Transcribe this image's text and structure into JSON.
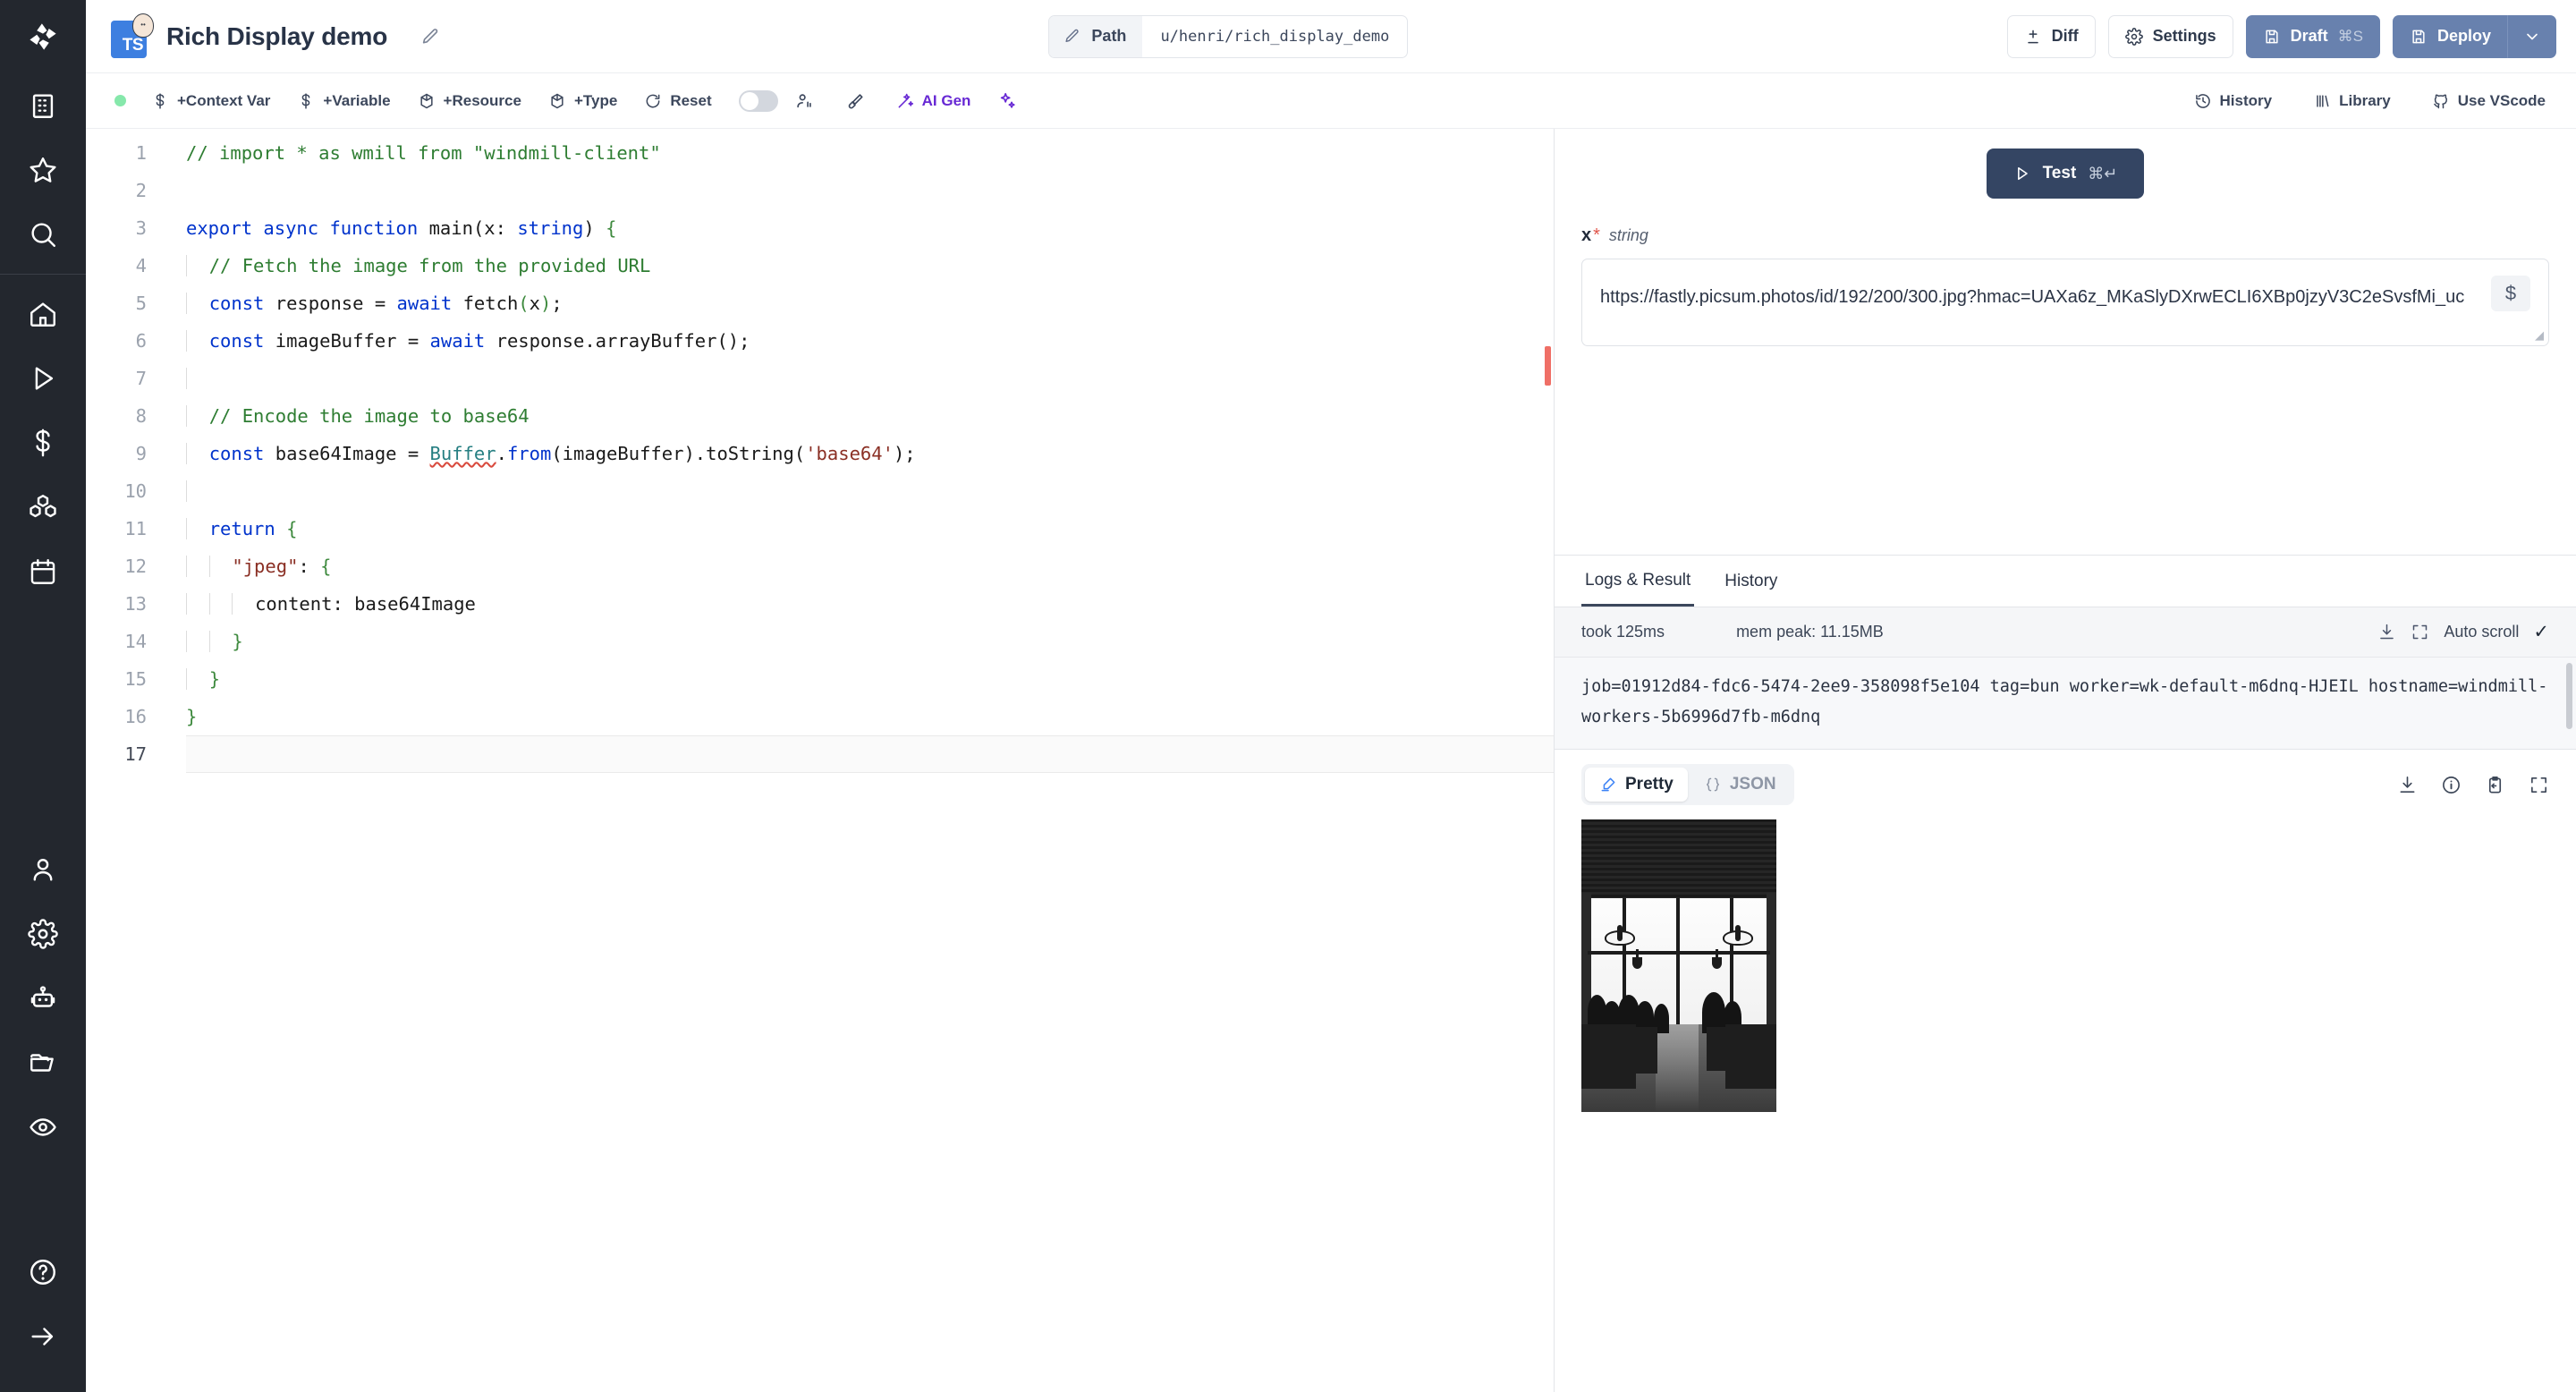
{
  "app": {
    "title": "Rich Display demo",
    "language_badge": "TS"
  },
  "topbar": {
    "edit_title_icon": "pencil-icon",
    "path": {
      "label": "Path",
      "value": "u/henri/rich_display_demo",
      "icon": "pencil-icon"
    },
    "diff_label": "Diff",
    "settings_label": "Settings",
    "draft_label": "Draft",
    "draft_shortcut": "⌘S",
    "deploy_label": "Deploy",
    "primary_color": "#6881ae"
  },
  "subbar": {
    "status": "ok",
    "items": [
      {
        "label": "+Context Var",
        "icon": "dollar-icon"
      },
      {
        "label": "+Variable",
        "icon": "dollar-icon"
      },
      {
        "label": "+Resource",
        "icon": "box-icon"
      },
      {
        "label": "+Type",
        "icon": "box-icon"
      },
      {
        "label": "Reset",
        "icon": "refresh-icon"
      }
    ],
    "collab_toggle": "off",
    "collab_icon": "users-icon",
    "format_icon": "brush-icon",
    "ai_gen_label": "AI Gen",
    "ai_gen_icon": "wand-icon",
    "ai_sparkle_icon": "sparkles-icon",
    "ai_color": "#6728d4",
    "right_items": [
      {
        "label": "History",
        "icon": "history-icon"
      },
      {
        "label": "Library",
        "icon": "library-icon"
      },
      {
        "label": "Use VScode",
        "icon": "github-icon"
      }
    ]
  },
  "sidebar": {
    "logo_icon": "windmill-logo-icon",
    "items": [
      {
        "name": "workspace",
        "icon": "building-icon"
      },
      {
        "name": "favorites",
        "icon": "star-icon"
      },
      {
        "name": "search",
        "icon": "search-icon"
      },
      {
        "name": "home",
        "icon": "home-icon"
      },
      {
        "name": "runs",
        "icon": "play-icon"
      },
      {
        "name": "variables",
        "icon": "dollar-icon"
      },
      {
        "name": "resources",
        "icon": "cubes-icon"
      },
      {
        "name": "schedules",
        "icon": "calendar-icon"
      },
      {
        "name": "workers",
        "icon": "user-icon"
      },
      {
        "name": "settings",
        "icon": "gear-icon"
      },
      {
        "name": "ai-agents",
        "icon": "robot-icon"
      },
      {
        "name": "folders",
        "icon": "folder-icon"
      },
      {
        "name": "audit-logs",
        "icon": "eye-icon"
      },
      {
        "name": "help",
        "icon": "question-circle-icon"
      },
      {
        "name": "expand-sidebar",
        "icon": "arrow-right-icon"
      }
    ]
  },
  "editor": {
    "total_lines": 17,
    "cursor_line": 17,
    "lines": [
      {
        "n": 1,
        "tokens": [
          {
            "t": "com",
            "v": "// import * as wmill from \"windmill-client\""
          }
        ]
      },
      {
        "n": 2,
        "tokens": []
      },
      {
        "n": 3,
        "tokens": [
          {
            "t": "kw",
            "v": "export"
          },
          {
            "t": "plain",
            "v": " "
          },
          {
            "t": "kw",
            "v": "async"
          },
          {
            "t": "plain",
            "v": " "
          },
          {
            "t": "kw",
            "v": "function"
          },
          {
            "t": "plain",
            "v": " "
          },
          {
            "t": "fn",
            "v": "main"
          },
          {
            "t": "punc",
            "v": "("
          },
          {
            "t": "plain",
            "v": "x: "
          },
          {
            "t": "type",
            "v": "string"
          },
          {
            "t": "punc",
            "v": ") "
          },
          {
            "t": "brace",
            "v": "{"
          }
        ]
      },
      {
        "n": 4,
        "indent": 1,
        "tokens": [
          {
            "t": "com",
            "v": "// Fetch the image from the provided URL"
          }
        ]
      },
      {
        "n": 5,
        "indent": 1,
        "tokens": [
          {
            "t": "kw",
            "v": "const"
          },
          {
            "t": "plain",
            "v": " response = "
          },
          {
            "t": "kw",
            "v": "await"
          },
          {
            "t": "plain",
            "v": " fetch"
          },
          {
            "t": "brace",
            "v": "("
          },
          {
            "t": "plain",
            "v": "x"
          },
          {
            "t": "brace",
            "v": ")"
          },
          {
            "t": "plain",
            "v": ";"
          }
        ]
      },
      {
        "n": 6,
        "indent": 1,
        "tokens": [
          {
            "t": "kw",
            "v": "const"
          },
          {
            "t": "plain",
            "v": " imageBuffer = "
          },
          {
            "t": "kw",
            "v": "await"
          },
          {
            "t": "plain",
            "v": " response.arrayBuffer();"
          }
        ]
      },
      {
        "n": 7,
        "indent": 1,
        "tokens": []
      },
      {
        "n": 8,
        "indent": 1,
        "tokens": [
          {
            "t": "com",
            "v": "// Encode the image to base64"
          }
        ]
      },
      {
        "n": 9,
        "indent": 1,
        "tokens": [
          {
            "t": "kw",
            "v": "const"
          },
          {
            "t": "plain",
            "v": " base64Image = "
          },
          {
            "t": "cls-squiggle",
            "v": "Buffer"
          },
          {
            "t": "plain",
            "v": "."
          },
          {
            "t": "kw",
            "v": "from"
          },
          {
            "t": "punc",
            "v": "("
          },
          {
            "t": "plain",
            "v": "imageBuffer"
          },
          {
            "t": "punc",
            "v": ")."
          },
          {
            "t": "plain",
            "v": "toString"
          },
          {
            "t": "punc",
            "v": "("
          },
          {
            "t": "str",
            "v": "'base64'"
          },
          {
            "t": "punc",
            "v": ");"
          }
        ]
      },
      {
        "n": 10,
        "indent": 1,
        "tokens": []
      },
      {
        "n": 11,
        "indent": 1,
        "tokens": [
          {
            "t": "kw",
            "v": "return"
          },
          {
            "t": "plain",
            "v": " "
          },
          {
            "t": "brace",
            "v": "{"
          }
        ]
      },
      {
        "n": 12,
        "indent": 2,
        "tokens": [
          {
            "t": "str",
            "v": "\"jpeg\""
          },
          {
            "t": "plain",
            "v": ": "
          },
          {
            "t": "brace",
            "v": "{"
          }
        ]
      },
      {
        "n": 13,
        "indent": 3,
        "tokens": [
          {
            "t": "plain",
            "v": "content: base64Image"
          }
        ]
      },
      {
        "n": 14,
        "indent": 2,
        "tokens": [
          {
            "t": "brace",
            "v": "}"
          }
        ]
      },
      {
        "n": 15,
        "indent": 1,
        "tokens": [
          {
            "t": "brace",
            "v": "}"
          }
        ]
      },
      {
        "n": 16,
        "tokens": [
          {
            "t": "brace",
            "v": "}"
          }
        ]
      },
      {
        "n": 17,
        "tokens": []
      }
    ]
  },
  "run_panel": {
    "test_label": "Test",
    "test_shortcut": "⌘↵",
    "arg_name": "x",
    "arg_required": "*",
    "arg_type": "string",
    "arg_value": "https://fastly.picsum.photos/id/192/200/300.jpg?hmac=UAXa6z_MKaSlyDXrwECLI6XBp0jzyV3C2eSvsfMi_uc",
    "dollar_chip": "$"
  },
  "logs": {
    "tabs": [
      {
        "label": "Logs & Result",
        "active": true
      },
      {
        "label": "History",
        "active": false
      }
    ],
    "took": "took 125ms",
    "mem_peak": "mem peak: 11.15MB",
    "auto_scroll_label": "Auto scroll",
    "auto_scroll_checked": "✓",
    "download_icon": "download-icon",
    "expand_icon": "expand-icon",
    "text": "job=01912d84-fdc6-5474-2ee9-358098f5e104 tag=bun worker=wk-default-m6dnq-HJEIL hostname=windmill-workers-5b6996d7fb-m6dnq"
  },
  "result": {
    "view_modes": [
      {
        "label": "Pretty",
        "icon": "highlighter-icon",
        "active": true
      },
      {
        "label": "JSON",
        "icon": "braces-icon",
        "active": false
      }
    ],
    "actions": [
      {
        "name": "download-result",
        "icon": "download-icon"
      },
      {
        "name": "result-info",
        "icon": "info-circle-icon"
      },
      {
        "name": "copy-result",
        "icon": "clipboard-icon"
      },
      {
        "name": "fullscreen-result",
        "icon": "expand-icon"
      }
    ],
    "image_alt": "black and white photo of a cafeteria interior with large windows, silhouetted people at tables and pendant lamps"
  }
}
